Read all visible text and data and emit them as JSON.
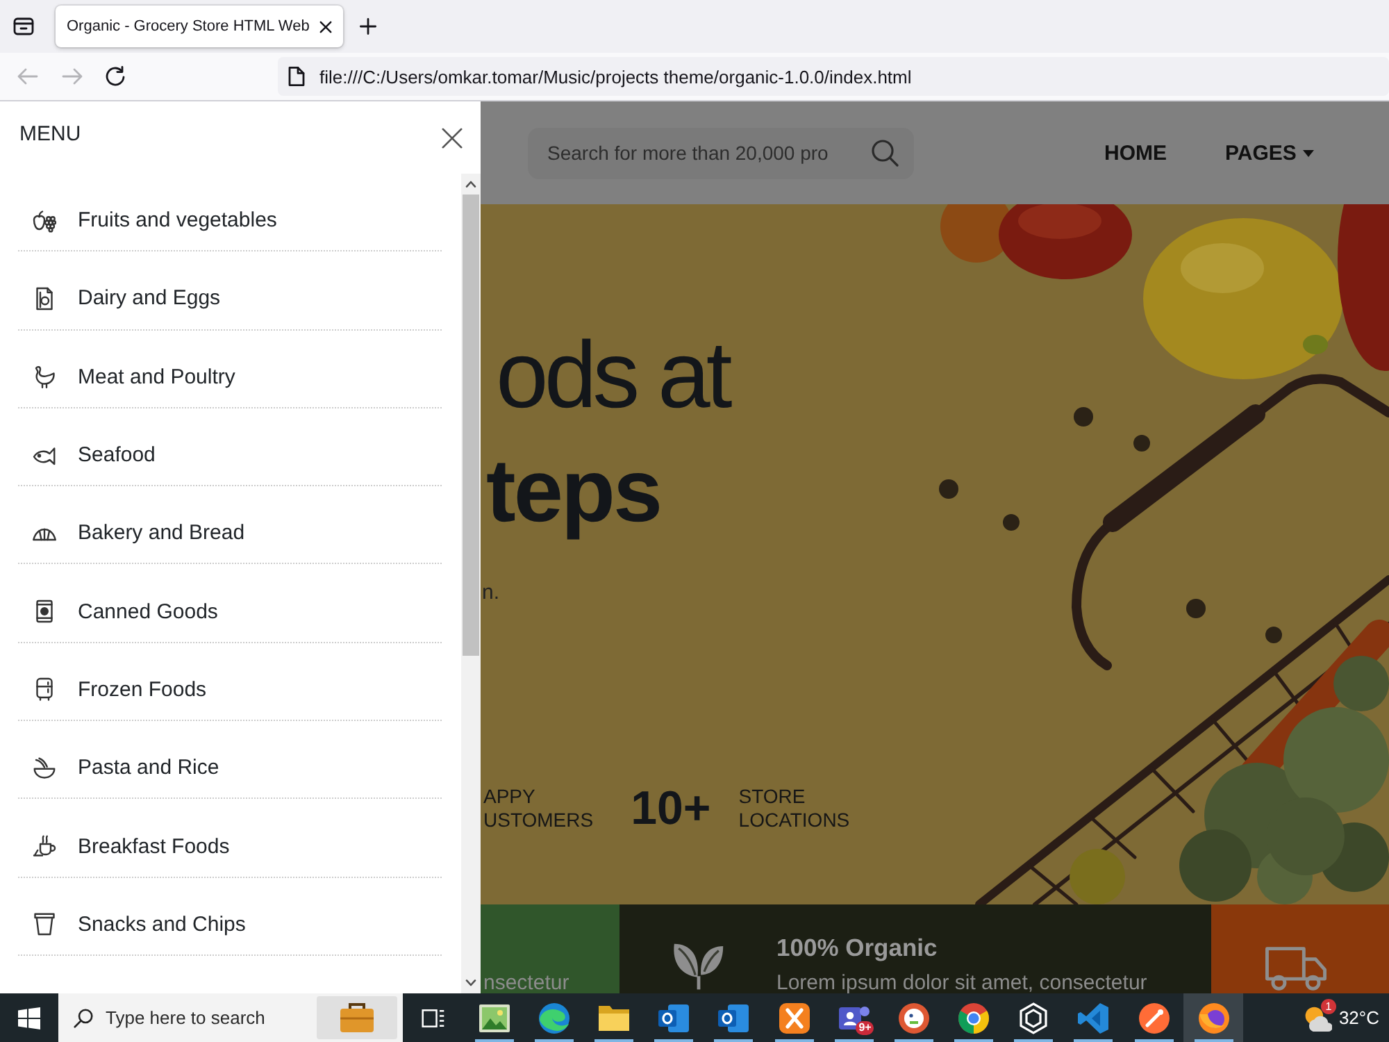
{
  "browser": {
    "tabs": [
      {
        "title": "Organic - Grocery Store HTML Web",
        "selected": true
      }
    ],
    "back_disabled": true,
    "forward_disabled": true,
    "url": "file:///C:/Users/omkar.tomar/Music/projects theme/organic-1.0.0/index.html"
  },
  "menu": {
    "title": "MENU",
    "items": [
      {
        "kind": "produce",
        "label": "Fruits and vegetables"
      },
      {
        "kind": "dairy",
        "label": "Dairy and Eggs"
      },
      {
        "kind": "poultry",
        "label": "Meat and Poultry"
      },
      {
        "kind": "seafood",
        "label": "Seafood"
      },
      {
        "kind": "bakery",
        "label": "Bakery and Bread"
      },
      {
        "kind": "canned",
        "label": "Canned Goods"
      },
      {
        "kind": "frozen",
        "label": "Frozen Foods"
      },
      {
        "kind": "pasta",
        "label": "Pasta and Rice"
      },
      {
        "kind": "breakfast",
        "label": "Breakfast Foods"
      },
      {
        "kind": "snacks",
        "label": "Snacks and Chips"
      }
    ]
  },
  "site_header": {
    "search": {
      "placeholder": "Search for more than 20,000 pro"
    },
    "nav": [
      {
        "label": "HOME",
        "dropdown": false
      },
      {
        "label": "PAGES",
        "dropdown": true
      }
    ]
  },
  "hero": {
    "title": "ods at",
    "title_bold": "teps",
    "subtitle": "n.",
    "stats": [
      {
        "label_lines": [
          "APPY",
          "USTOMERS"
        ]
      },
      {
        "number": "10+",
        "label_lines": [
          "STORE",
          "LOCATIONS"
        ]
      }
    ]
  },
  "features": [
    {
      "kind": "text",
      "color": "#30562b",
      "text": "nsectetur"
    },
    {
      "kind": "leaf",
      "color": "#1c1f14",
      "title": "100% Organic",
      "text": "Lorem ipsum dolor sit amet, consectetur"
    },
    {
      "kind": "truck",
      "color": "#8a380b"
    }
  ],
  "taskbar": {
    "search": {
      "placeholder": "Type here to search"
    },
    "apps": [
      {
        "kind": "picture",
        "running": true,
        "selected": false
      },
      {
        "kind": "swirl",
        "running": true,
        "selected": false
      },
      {
        "kind": "folder",
        "running": true,
        "selected": false
      },
      {
        "kind": "mail",
        "running": true,
        "selected": false
      },
      {
        "kind": "mail",
        "running": true,
        "selected": false
      },
      {
        "kind": "cross",
        "running": true,
        "selected": false
      },
      {
        "kind": "people",
        "running": true,
        "selected": false,
        "badge": "9+"
      },
      {
        "kind": "round",
        "running": true,
        "selected": false
      },
      {
        "kind": "wheel",
        "running": true,
        "selected": false
      },
      {
        "kind": "knot",
        "running": true,
        "selected": false
      },
      {
        "kind": "ribbon",
        "running": true,
        "selected": false
      },
      {
        "kind": "slash",
        "running": true,
        "selected": false
      },
      {
        "kind": "flame",
        "running": true,
        "selected": true
      }
    ],
    "weather": {
      "badge": "1",
      "temperature": "32°C"
    }
  }
}
